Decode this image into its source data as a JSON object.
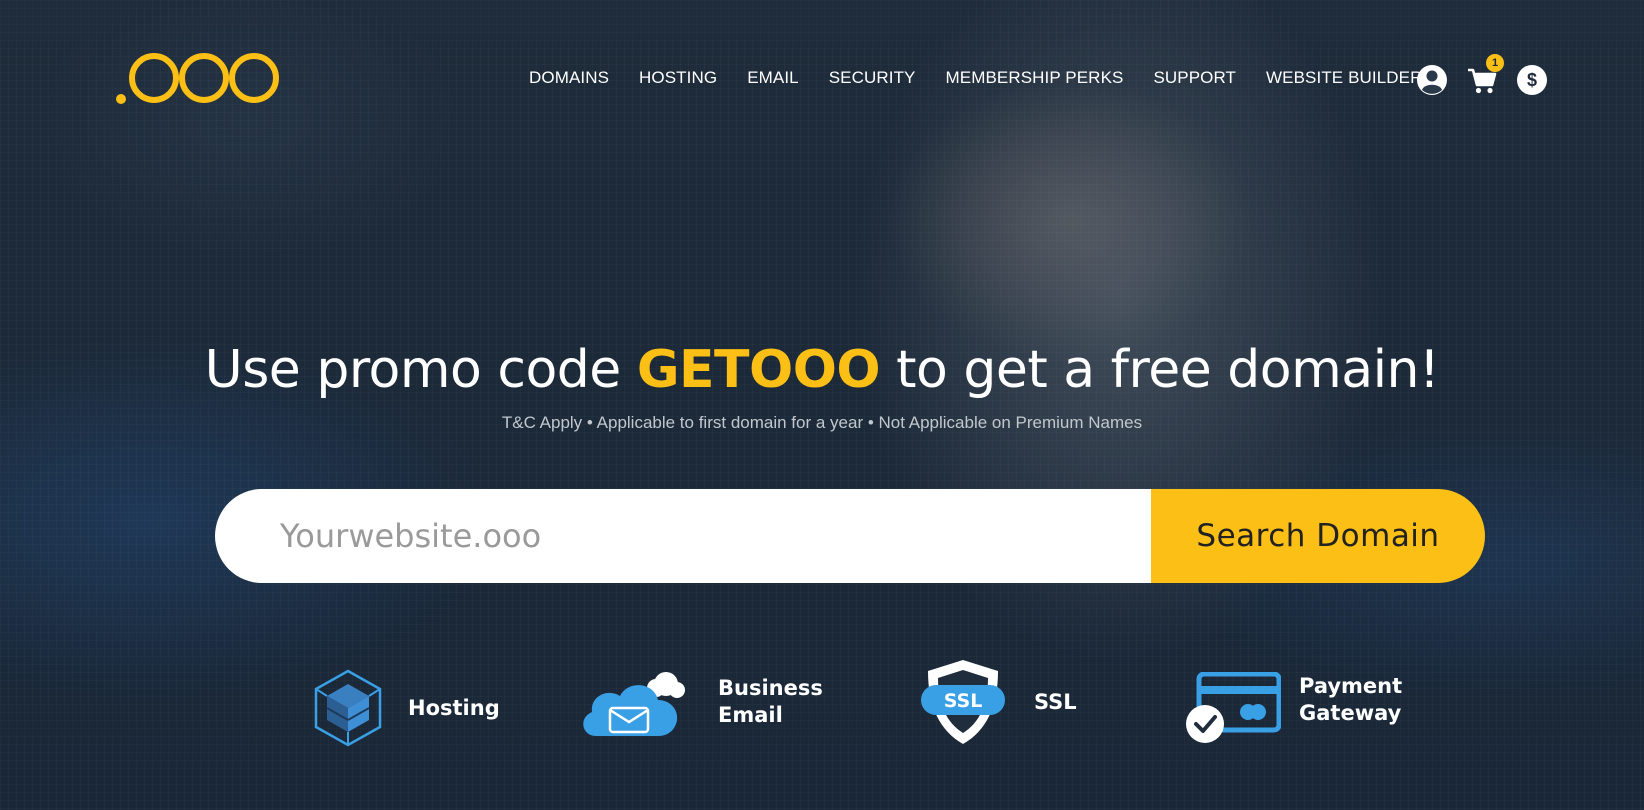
{
  "brand": {
    "logo_text": ".ooo",
    "accent": "#fbbf15"
  },
  "nav": {
    "items": [
      {
        "label": "DOMAINS"
      },
      {
        "label": "HOSTING"
      },
      {
        "label": "EMAIL"
      },
      {
        "label": "SECURITY"
      },
      {
        "label": "MEMBERSHIP PERKS"
      },
      {
        "label": "SUPPORT"
      },
      {
        "label": "WEBSITE BUILDER"
      }
    ]
  },
  "header_icons": {
    "user": "user-icon",
    "cart": "cart-icon",
    "cart_count": "1",
    "currency": "$"
  },
  "hero": {
    "headline_before": "Use promo code ",
    "promo_code": "GETOOO",
    "headline_after": " to get a free domain!",
    "subline": "T&C Apply • Applicable to first domain for a year • Not Applicable on Premium Names"
  },
  "search": {
    "placeholder": "Yourwebsite.ooo",
    "value": "",
    "button_label": "Search Domain"
  },
  "features": [
    {
      "icon": "hosting-cube-icon",
      "line1": "Hosting",
      "line2": ""
    },
    {
      "icon": "cloud-email-icon",
      "line1": "Business",
      "line2": "Email"
    },
    {
      "icon": "ssl-shield-icon",
      "icon_text": "SSL",
      "line1": "SSL",
      "line2": ""
    },
    {
      "icon": "payment-card-icon",
      "line1": "Payment",
      "line2": "Gateway"
    }
  ]
}
